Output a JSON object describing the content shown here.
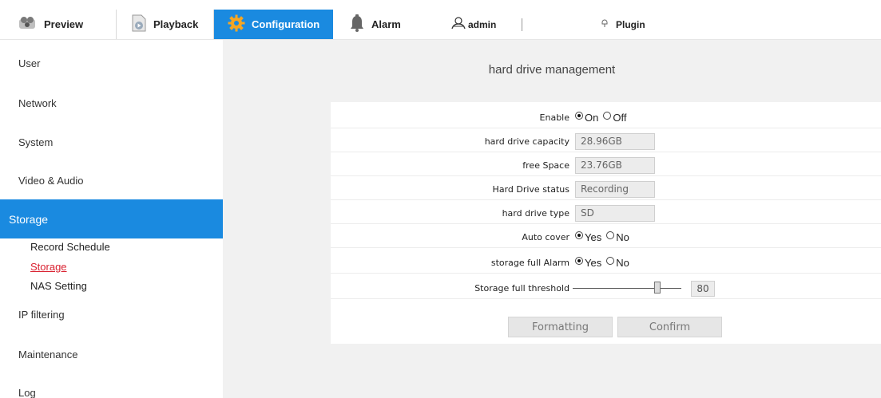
{
  "nav": {
    "preview": "Preview",
    "playback": "Playback",
    "configuration": "Configuration",
    "alarm": "Alarm",
    "user": "admin",
    "plugin": "Plugin"
  },
  "sidebar": {
    "items": [
      "User",
      "Network",
      "System",
      "Video & Audio",
      "Storage",
      "IP filtering",
      "Maintenance",
      "Log"
    ],
    "sub_items": [
      "Record Schedule",
      "Storage",
      "NAS Setting"
    ]
  },
  "main": {
    "title": "hard drive management",
    "enable": {
      "label": "Enable",
      "opt1": "On",
      "opt2": "Off",
      "selected": "On"
    },
    "capacity": {
      "label": "hard drive capacity",
      "value": "28.96GB"
    },
    "free": {
      "label": "free Space",
      "value": "23.76GB"
    },
    "status": {
      "label": "Hard Drive status",
      "value": "Recording"
    },
    "type": {
      "label": "hard drive type",
      "value": "SD"
    },
    "auto_cover": {
      "label": "Auto cover",
      "opt1": "Yes",
      "opt2": "No",
      "selected": "Yes"
    },
    "full_alarm": {
      "label": "storage full Alarm",
      "opt1": "Yes",
      "opt2": "No",
      "selected": "Yes"
    },
    "threshold": {
      "label": "Storage full threshold",
      "value": "80"
    },
    "buttons": {
      "format": "Formatting",
      "confirm": "Confirm"
    }
  },
  "colors": {
    "accent": "#1a8ae0",
    "current_link": "#d9202f",
    "main_bg": "#f1f1f1"
  }
}
